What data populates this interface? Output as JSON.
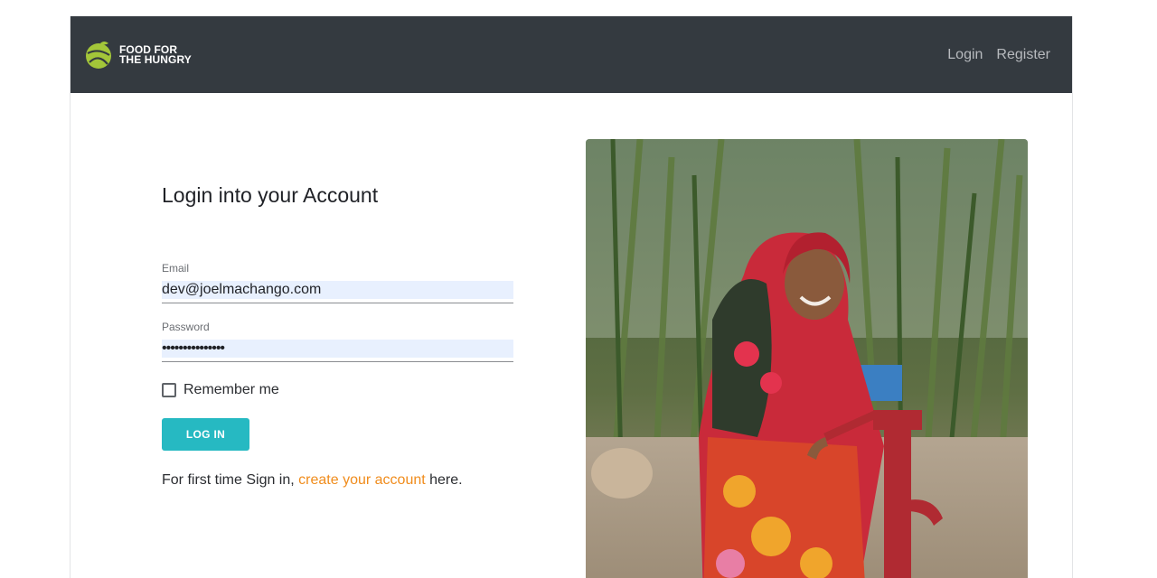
{
  "brand": {
    "line1": "FOOD FOR",
    "line2": "THE HUNGRY",
    "logo_icon": "globe-leaf-icon",
    "logo_color": "#a3c639"
  },
  "nav": {
    "login": "Login",
    "register": "Register"
  },
  "form": {
    "heading": "Login into your Account",
    "email_label": "Email",
    "email_value": "dev@joelmachango.com",
    "password_label": "Password",
    "password_value": "•••••••••••••••",
    "remember_label": "Remember me",
    "remember_checked": false,
    "submit_label": "LOG IN",
    "signup_prefix": "For first time Sign in, ",
    "signup_link": "create your account",
    "signup_suffix": " here."
  },
  "colors": {
    "navbar": "#343a40",
    "button": "#26b9c2",
    "link": "#f08c1c",
    "autofill": "#e8f0fe"
  }
}
